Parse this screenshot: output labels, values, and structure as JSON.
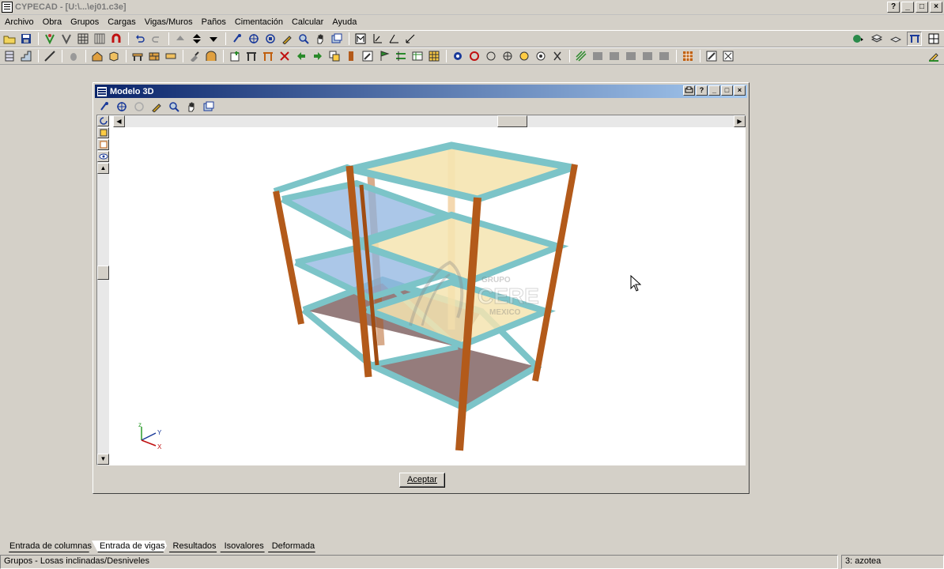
{
  "app": {
    "title": "CYPECAD - [U:\\...\\ej01.c3e]",
    "caption_buttons": [
      "?",
      "_",
      "□",
      "×"
    ]
  },
  "menu": [
    "Archivo",
    "Obra",
    "Grupos",
    "Cargas",
    "Vigas/Muros",
    "Paños",
    "Cimentación",
    "Calcular",
    "Ayuda"
  ],
  "dialog": {
    "title": "Modelo 3D",
    "caption_buttons": [
      "?",
      "_",
      "□",
      "×"
    ],
    "accept_label": "Aceptar",
    "axis_labels": {
      "z": "z",
      "y": "Y",
      "x": "X"
    },
    "watermark": {
      "line1": "GRUPO",
      "line2": "CERE",
      "line3": "MEXICO"
    }
  },
  "tabs": [
    {
      "label": "Entrada de columnas",
      "active": false
    },
    {
      "label": "Entrada de vigas",
      "active": true
    },
    {
      "label": "Resultados",
      "active": false
    },
    {
      "label": "Isovalores",
      "active": false
    },
    {
      "label": "Deformada",
      "active": false
    }
  ],
  "status": {
    "left": "Grupos - Losas inclinadas/Desniveles",
    "right": "3: azotea"
  },
  "colors": {
    "column": "#b35a1a",
    "beam": "#7cc4c8",
    "slab_yellow": "#f5e4b0",
    "slab_blue": "#8fb4e0",
    "foundation": "#8a6e6e",
    "titlebar_start": "#0a246a"
  },
  "icons": {
    "toolbar1": [
      "open-icon",
      "save-icon",
      "tree-icon",
      "tree2-icon",
      "grid-icon",
      "grid2-icon",
      "magnet-icon",
      "undo-icon",
      "redo-icon",
      "up-arrow-icon",
      "updown-arrow-icon",
      "down-arrow-icon",
      "rotate-icon",
      "zoom-extents-icon",
      "zoom-window-icon",
      "pen-icon",
      "zoom-icon",
      "pan-icon",
      "window-icon",
      "plan-icon",
      "axes-icon",
      "angle-icon",
      "line-icon"
    ],
    "toolbar2": [
      "column-icon",
      "stair-icon",
      "ramp-icon",
      "hand-icon",
      "house-icon",
      "box-icon"
    ]
  }
}
